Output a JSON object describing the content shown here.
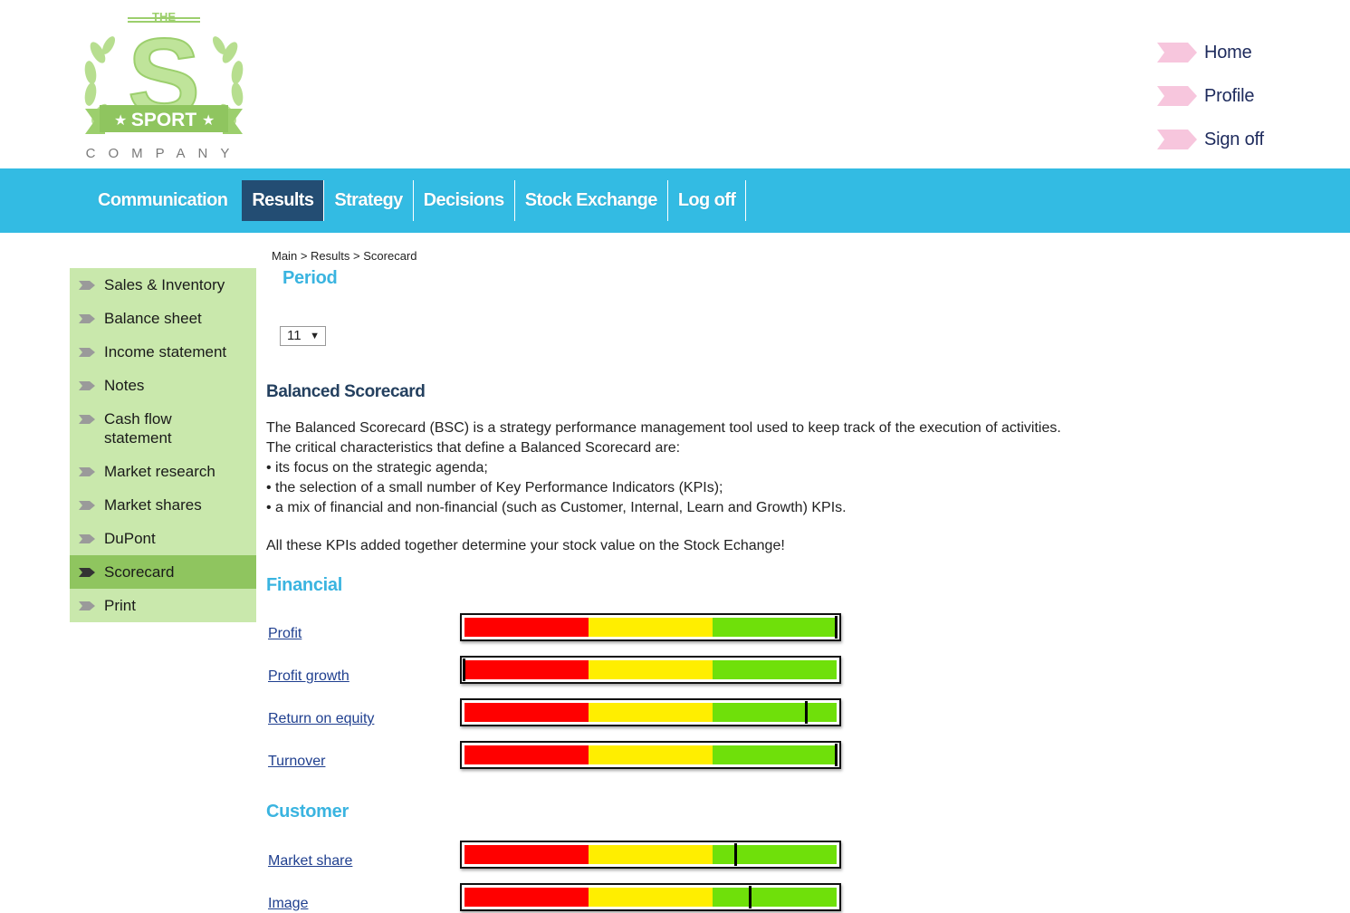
{
  "brand": {
    "logo_top": "THE",
    "logo_letter": "S",
    "logo_ribbon": "SPORT",
    "logo_bottom": "COMPANY"
  },
  "top_links": [
    {
      "label": "Home"
    },
    {
      "label": "Profile"
    },
    {
      "label": "Sign off"
    }
  ],
  "nav": [
    {
      "label": "Communication",
      "active": false
    },
    {
      "label": "Results",
      "active": true
    },
    {
      "label": "Strategy",
      "active": false
    },
    {
      "label": "Decisions",
      "active": false
    },
    {
      "label": "Stock Exchange",
      "active": false
    },
    {
      "label": "Log off",
      "active": false
    }
  ],
  "sidebar": [
    {
      "label": "Sales & Inventory",
      "active": false
    },
    {
      "label": "Balance sheet",
      "active": false
    },
    {
      "label": "Income statement",
      "active": false
    },
    {
      "label": "Notes",
      "active": false
    },
    {
      "label": "Cash flow statement",
      "active": false
    },
    {
      "label": "Market research",
      "active": false
    },
    {
      "label": "Market shares",
      "active": false
    },
    {
      "label": "DuPont",
      "active": false
    },
    {
      "label": "Scorecard",
      "active": true
    },
    {
      "label": "Print",
      "active": false
    }
  ],
  "breadcrumb": {
    "main": "Main",
    "results": "Results",
    "current": "Scorecard",
    "separator": ">"
  },
  "period": {
    "title": "Period",
    "selected": "11",
    "caret": "▼"
  },
  "bsc": {
    "title": "Balanced Scorecard",
    "intro": [
      "The Balanced Scorecard (BSC) is a strategy performance management tool used to keep track of the execution of activities.",
      "The critical characteristics that define a Balanced Scorecard are:",
      "• its focus on the strategic agenda;",
      "• the selection of a small number of Key Performance Indicators (KPIs);",
      "• a mix of financial and non-financial (such as Customer, Internal, Learn and Growth) KPIs."
    ],
    "closing": "All these KPIs added together determine your stock value on the Stock Echange!"
  },
  "sections": [
    {
      "title": "Financial",
      "kpis": [
        {
          "label": "Profit",
          "score": 1.0
        },
        {
          "label": "Profit growth",
          "score": 0.0
        },
        {
          "label": "Return on equity",
          "score": 0.92
        },
        {
          "label": "Turnover",
          "score": 1.0
        }
      ]
    },
    {
      "title": "Customer",
      "kpis": [
        {
          "label": "Market share",
          "score": 0.73
        },
        {
          "label": "Image",
          "score": 0.77
        }
      ]
    }
  ],
  "colors": {
    "nav_bg": "#33bbe3",
    "nav_active": "#234d73",
    "sidebar_bg": "#c9e8ac",
    "sidebar_active": "#8fc55f",
    "accent_title": "#3ab4e0",
    "bar_red": "#ff0000",
    "bar_yellow": "#ffee00",
    "bar_green": "#6fe00a",
    "link": "#1f3f8f",
    "top_arrow": "#f7c6dd"
  }
}
